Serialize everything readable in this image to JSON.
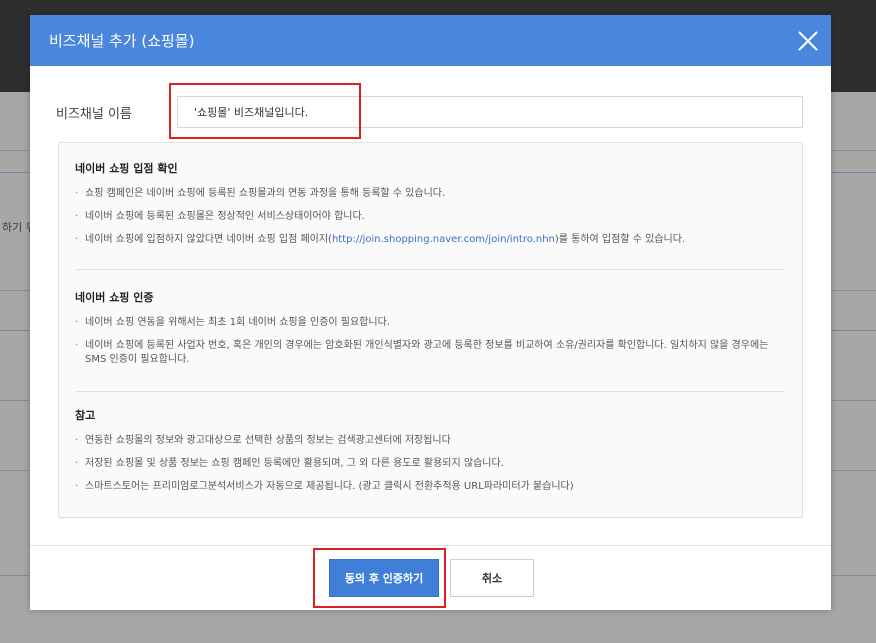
{
  "modal": {
    "title": "비즈채널 추가 (쇼핑몰)",
    "name_label": "비즈채널 이름",
    "name_value": "'쇼핑몰' 비즈채널입니다."
  },
  "background": {
    "partial_text": "하기 위"
  },
  "info": {
    "sections": [
      {
        "heading": "네이버 쇼핑 입점 확인",
        "items": [
          "쇼핑 캠페인은 네이버 쇼핑에 등록된 쇼핑몰과의 연동 과정을 통해 등록할 수 있습니다.",
          "네이버 쇼핑에 등록된 쇼핑몰은 정상적인 서비스상태이어야 합니다.",
          {
            "before": "네이버 쇼핑에 입점하지 않았다면 네이버 쇼핑 입점 페이지(",
            "link": "http://join.shopping.naver.com/join/intro.nhn",
            "after": ")를 통하여 입점할 수 있습니다."
          }
        ]
      },
      {
        "heading": "네이버 쇼핑 인증",
        "items": [
          "네이버 쇼핑 연동을 위해서는 최초 1회 네이버 쇼핑을 인증이 필요합니다.",
          "네이버 쇼핑에 등록된 사업자 번호, 혹은 개인의 경우에는 암호화된 개인식별자와 광고에 등록한 정보를 비교하여 소유/권리자를 확인합니다. 일치하지 않을 경우에는 SMS 인증이 필요합니다."
        ]
      },
      {
        "heading": "참고",
        "items": [
          "연동한 쇼핑몰의 정보와 광고대상으로 선택한 상품의 정보는 검색광고센터에 저장됩니다",
          "저장된 쇼핑몰 및 상품 정보는 쇼핑 캠페인 등록에만 활용되며, 그 외 다른 용도로 활용되지 않습니다.",
          "스마트스토어는 프리미엄로그분석서비스가 자동으로 제공됩니다. (광고 클릭시 전환추적용 URL파라미터가 붙습니다)"
        ]
      }
    ]
  },
  "buttons": {
    "confirm": "동의 후 인증하기",
    "cancel": "취소"
  },
  "colors": {
    "header": "#4a86db",
    "primary_button": "#3f7fd8",
    "highlight": "#e02020",
    "link": "#3a6fc4"
  }
}
